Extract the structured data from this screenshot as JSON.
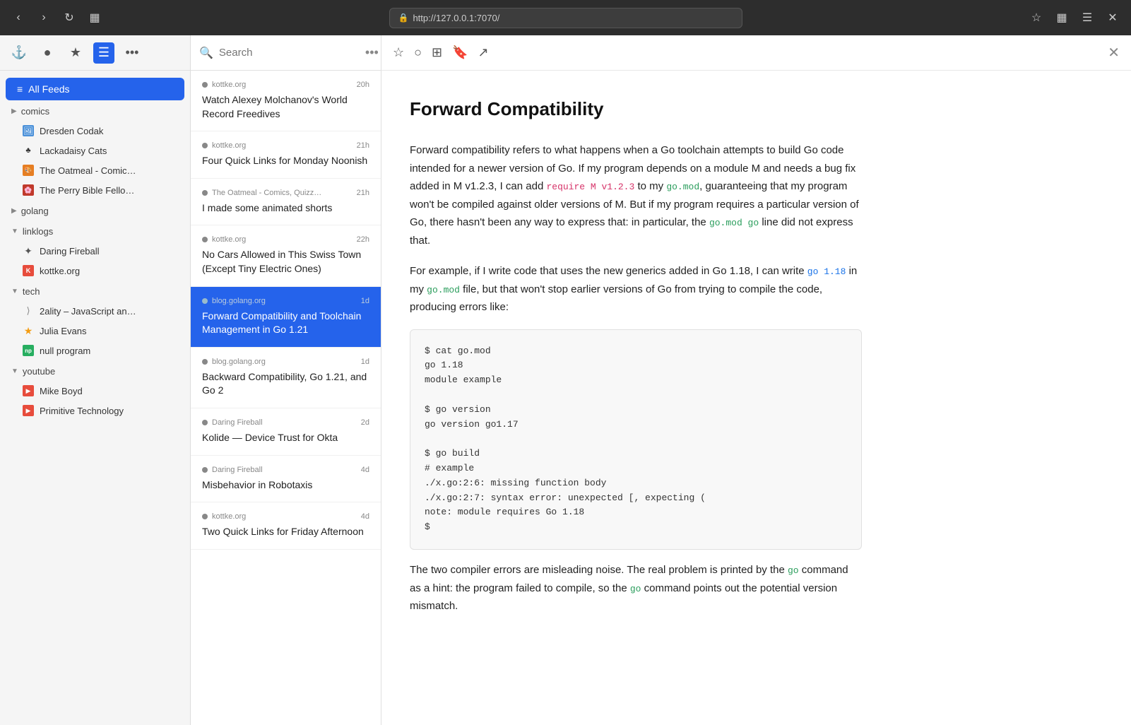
{
  "browser": {
    "url": "http://127.0.0.1:7070/",
    "back_disabled": false,
    "forward_disabled": false
  },
  "sidebar": {
    "all_feeds_label": "All Feeds",
    "categories": [
      {
        "name": "comics",
        "expanded": false,
        "feeds": [
          {
            "name": "Dresden Codak",
            "icon": "🖼",
            "color": "#4a90d9"
          },
          {
            "name": "Lackadaisy Cats",
            "icon": "♣",
            "color": "#333"
          },
          {
            "name": "The Oatmeal - Comic…",
            "icon": "🎨",
            "color": "#e67e22"
          },
          {
            "name": "The Perry Bible Fello…",
            "icon": "🌸",
            "color": "#c0392b"
          }
        ]
      },
      {
        "name": "golang",
        "expanded": false,
        "feeds": []
      },
      {
        "name": "linklogs",
        "expanded": true,
        "feeds": [
          {
            "name": "Daring Fireball",
            "icon": "⭐",
            "color": "#555",
            "style": "star"
          },
          {
            "name": "kottke.org",
            "icon": "K",
            "color": "#e74c3c"
          }
        ]
      },
      {
        "name": "tech",
        "expanded": true,
        "feeds": [
          {
            "name": "2ality – JavaScript an…",
            "icon": "⟩",
            "color": "#888"
          },
          {
            "name": "Julia Evans",
            "icon": "★",
            "color": "#f39c12"
          },
          {
            "name": "null program",
            "icon": "np",
            "color": "#27ae60"
          }
        ]
      },
      {
        "name": "youtube",
        "expanded": true,
        "feeds": [
          {
            "name": "Mike Boyd",
            "icon": "▶",
            "color": "#e74c3c"
          },
          {
            "name": "Primitive Technology",
            "icon": "▶",
            "color": "#e74c3c"
          }
        ]
      }
    ]
  },
  "feed_list": {
    "search_placeholder": "Search",
    "articles": [
      {
        "source": "kottke.org",
        "age": "20h",
        "title": "Watch Alexey Molchanov's World Record Freedives",
        "selected": false
      },
      {
        "source": "kottke.org",
        "age": "21h",
        "title": "Four Quick Links for Monday Noonish",
        "selected": false
      },
      {
        "source": "The Oatmeal - Comics, Quizz…",
        "age": "21h",
        "title": "I made some animated shorts",
        "selected": false
      },
      {
        "source": "kottke.org",
        "age": "22h",
        "title": "No Cars Allowed in This Swiss Town (Except Tiny Electric Ones)",
        "selected": false
      },
      {
        "source": "blog.golang.org",
        "age": "1d",
        "title": "Forward Compatibility and Toolchain Management in Go 1.21",
        "selected": true
      },
      {
        "source": "blog.golang.org",
        "age": "1d",
        "title": "Backward Compatibility, Go 1.21, and Go 2",
        "selected": false
      },
      {
        "source": "Daring Fireball",
        "age": "2d",
        "title": "Kolide — Device Trust for Okta",
        "selected": false
      },
      {
        "source": "Daring Fireball",
        "age": "4d",
        "title": "Misbehavior in Robotaxis",
        "selected": false
      },
      {
        "source": "kottke.org",
        "age": "4d",
        "title": "Two Quick Links for Friday Afternoon",
        "selected": false
      }
    ]
  },
  "article": {
    "title": "Forward Compatibility",
    "paragraphs": {
      "p1": "Forward compatibility refers to what happens when a Go toolchain attempts to build Go code intended for a newer version of Go. If my program depends on a module M and needs a bug fix added in M v1.2.3, I can add ",
      "p1_code1": "require M v1.2.3",
      "p1_mid": " to my ",
      "p1_code2": "go.mod",
      "p1_end": ", guaranteeing that my program won't be compiled against older versions of M. But if my program requires a particular version of Go, there hasn't been any way to express that: in particular, the ",
      "p1_code3": "go.mod go",
      "p1_end2": " line did not express that.",
      "p2": "For example, if I write code that uses the new generics added in Go 1.18, I can write ",
      "p2_code1": "go 1.18",
      "p2_mid": " in my ",
      "p2_code2": "go.mod",
      "p2_end": " file, but that won't stop earlier versions of Go from trying to compile the code, producing errors like:",
      "code_block": "$ cat go.mod\ngo 1.18\nmodule example\n\n$ go version\ngo version go1.17\n\n$ go build\n# example\n./x.go:2:6: missing function body\n./x.go:2:7: syntax error: unexpected [, expecting (\nnote: module requires Go 1.18\n$",
      "p3": "The two compiler errors are misleading noise. The real problem is printed by the ",
      "p3_code1": "go",
      "p3_mid": " command as a hint: the program failed to compile, so the ",
      "p3_code2": "go",
      "p3_end": " command points out the potential version mismatch."
    }
  }
}
